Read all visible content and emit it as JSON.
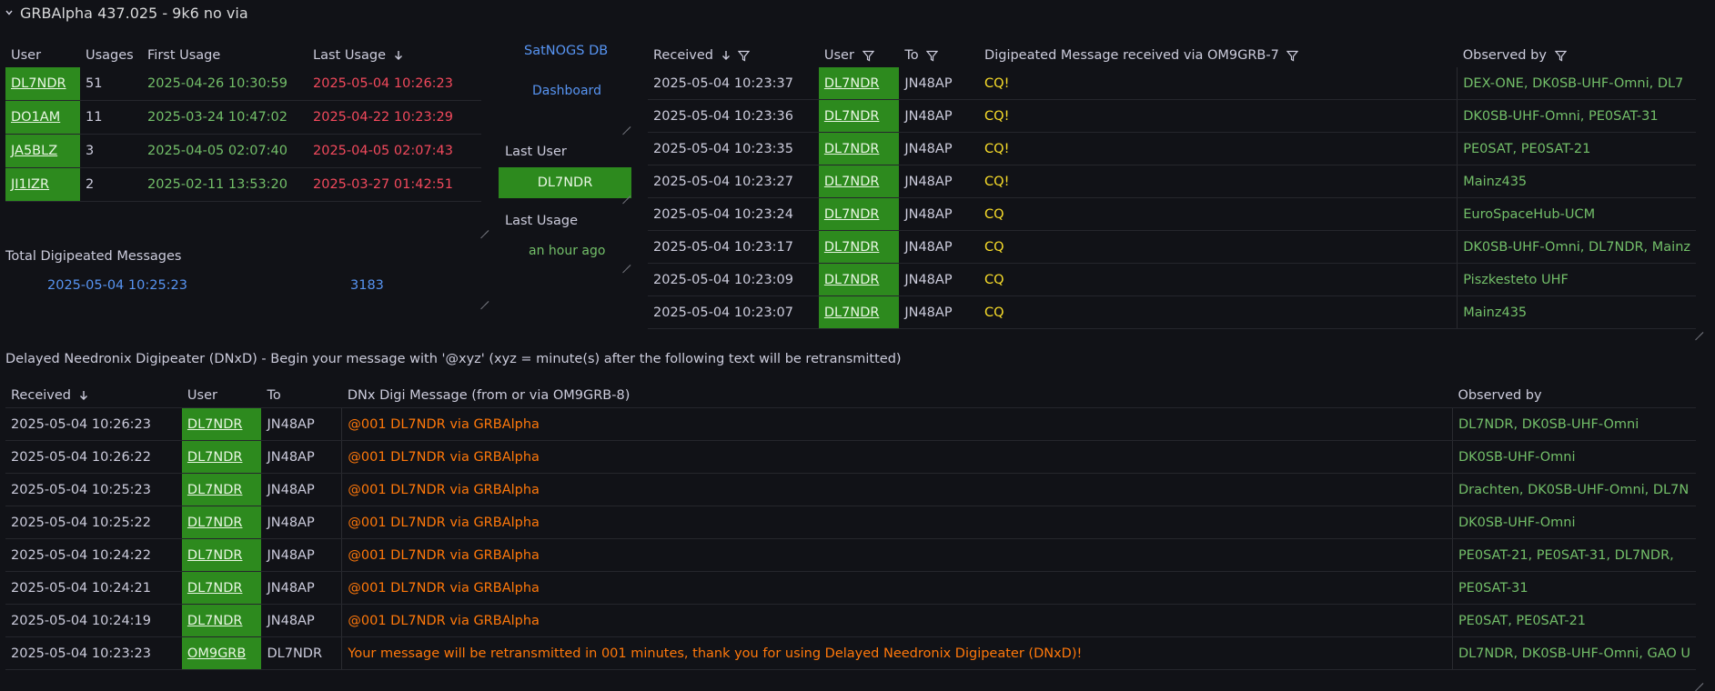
{
  "panel_title": "GRBAlpha 437.025 - 9k6 no via",
  "users_table": {
    "headers": [
      "User",
      "Usages",
      "First Usage",
      "Last Usage"
    ],
    "rows": [
      {
        "user": "DL7NDR",
        "usages": "51",
        "first": "2025-04-26 10:30:59",
        "last": "2025-05-04 10:26:23"
      },
      {
        "user": "DO1AM",
        "usages": "11",
        "first": "2025-03-24 10:47:02",
        "last": "2025-04-22 10:23:29"
      },
      {
        "user": "JA5BLZ",
        "usages": "3",
        "first": "2025-04-05 02:07:40",
        "last": "2025-04-05 02:07:43"
      },
      {
        "user": "JI1IZR",
        "usages": "2",
        "first": "2025-02-11 13:53:20",
        "last": "2025-03-27 01:42:51"
      }
    ]
  },
  "total": {
    "label": "Total Digipeated Messages",
    "time": "2025-05-04 10:25:23",
    "count": "3183"
  },
  "links": {
    "satnogs": "SatNOGS DB",
    "dashboard": "Dashboard"
  },
  "last_user": {
    "label": "Last User",
    "value": "DL7NDR"
  },
  "last_usage": {
    "label": "Last Usage",
    "value": "an hour ago"
  },
  "digi_table": {
    "headers": [
      "Received",
      "User",
      "To",
      "Digipeated Message received via OM9GRB-7",
      "Observed by"
    ],
    "rows": [
      {
        "received": "2025-05-04 10:23:37",
        "user": "DL7NDR",
        "to": "JN48AP",
        "msg": "CQ!",
        "observed": "DEX-ONE, DK0SB-UHF-Omni, DL7"
      },
      {
        "received": "2025-05-04 10:23:36",
        "user": "DL7NDR",
        "to": "JN48AP",
        "msg": "CQ!",
        "observed": "DK0SB-UHF-Omni, PE0SAT-31"
      },
      {
        "received": "2025-05-04 10:23:35",
        "user": "DL7NDR",
        "to": "JN48AP",
        "msg": "CQ!",
        "observed": "PE0SAT, PE0SAT-21"
      },
      {
        "received": "2025-05-04 10:23:27",
        "user": "DL7NDR",
        "to": "JN48AP",
        "msg": "CQ!",
        "observed": "Mainz435"
      },
      {
        "received": "2025-05-04 10:23:24",
        "user": "DL7NDR",
        "to": "JN48AP",
        "msg": "CQ",
        "observed": "EuroSpaceHub-UCM"
      },
      {
        "received": "2025-05-04 10:23:17",
        "user": "DL7NDR",
        "to": "JN48AP",
        "msg": "CQ",
        "observed": "DK0SB-UHF-Omni, DL7NDR, Mainz"
      },
      {
        "received": "2025-05-04 10:23:09",
        "user": "DL7NDR",
        "to": "JN48AP",
        "msg": "CQ",
        "observed": "Piszkesteto UHF"
      },
      {
        "received": "2025-05-04 10:23:07",
        "user": "DL7NDR",
        "to": "JN48AP",
        "msg": "CQ",
        "observed": "Mainz435"
      }
    ]
  },
  "dnx_title": "Delayed Needronix Digipeater (DNxD) - Begin your message with '@xyz' (xyz = minute(s) after the following text will be retransmitted)",
  "dnx_table": {
    "headers": [
      "Received",
      "User",
      "To",
      "DNx Digi Message (from or via OM9GRB-8)",
      "Observed by"
    ],
    "rows": [
      {
        "received": "2025-05-04 10:26:23",
        "user": "DL7NDR",
        "to": "JN48AP",
        "msg": "@001 DL7NDR via GRBAlpha",
        "observed": "DL7NDR, DK0SB-UHF-Omni"
      },
      {
        "received": "2025-05-04 10:26:22",
        "user": "DL7NDR",
        "to": "JN48AP",
        "msg": "@001 DL7NDR via GRBAlpha",
        "observed": "DK0SB-UHF-Omni"
      },
      {
        "received": "2025-05-04 10:25:23",
        "user": "DL7NDR",
        "to": "JN48AP",
        "msg": "@001 DL7NDR via GRBAlpha",
        "observed": "Drachten, DK0SB-UHF-Omni, DL7N"
      },
      {
        "received": "2025-05-04 10:25:22",
        "user": "DL7NDR",
        "to": "JN48AP",
        "msg": "@001 DL7NDR via GRBAlpha",
        "observed": "DK0SB-UHF-Omni"
      },
      {
        "received": "2025-05-04 10:24:22",
        "user": "DL7NDR",
        "to": "JN48AP",
        "msg": "@001 DL7NDR via GRBAlpha",
        "observed": "PE0SAT-21, PE0SAT-31, DL7NDR,"
      },
      {
        "received": "2025-05-04 10:24:21",
        "user": "DL7NDR",
        "to": "JN48AP",
        "msg": "@001 DL7NDR via GRBAlpha",
        "observed": "PE0SAT-31"
      },
      {
        "received": "2025-05-04 10:24:19",
        "user": "DL7NDR",
        "to": "JN48AP",
        "msg": "@001 DL7NDR via GRBAlpha",
        "observed": "PE0SAT, PE0SAT-21"
      },
      {
        "received": "2025-05-04 10:23:23",
        "user": "OM9GRB",
        "to": "DL7NDR",
        "msg": "Your message will be retransmitted in 001 minutes, thank you for using Delayed Needronix Digipeater (DNxD)!",
        "observed": "DL7NDR, DK0SB-UHF-Omni, GAO U"
      }
    ]
  },
  "colors": {
    "background": "#111217",
    "green_cell": "#2d8a1e",
    "green_text": "#73bf69",
    "red_text": "#f2495c",
    "yellow_text": "#fade2a",
    "orange_text": "#ff780a",
    "blue_text": "#5794f2"
  }
}
